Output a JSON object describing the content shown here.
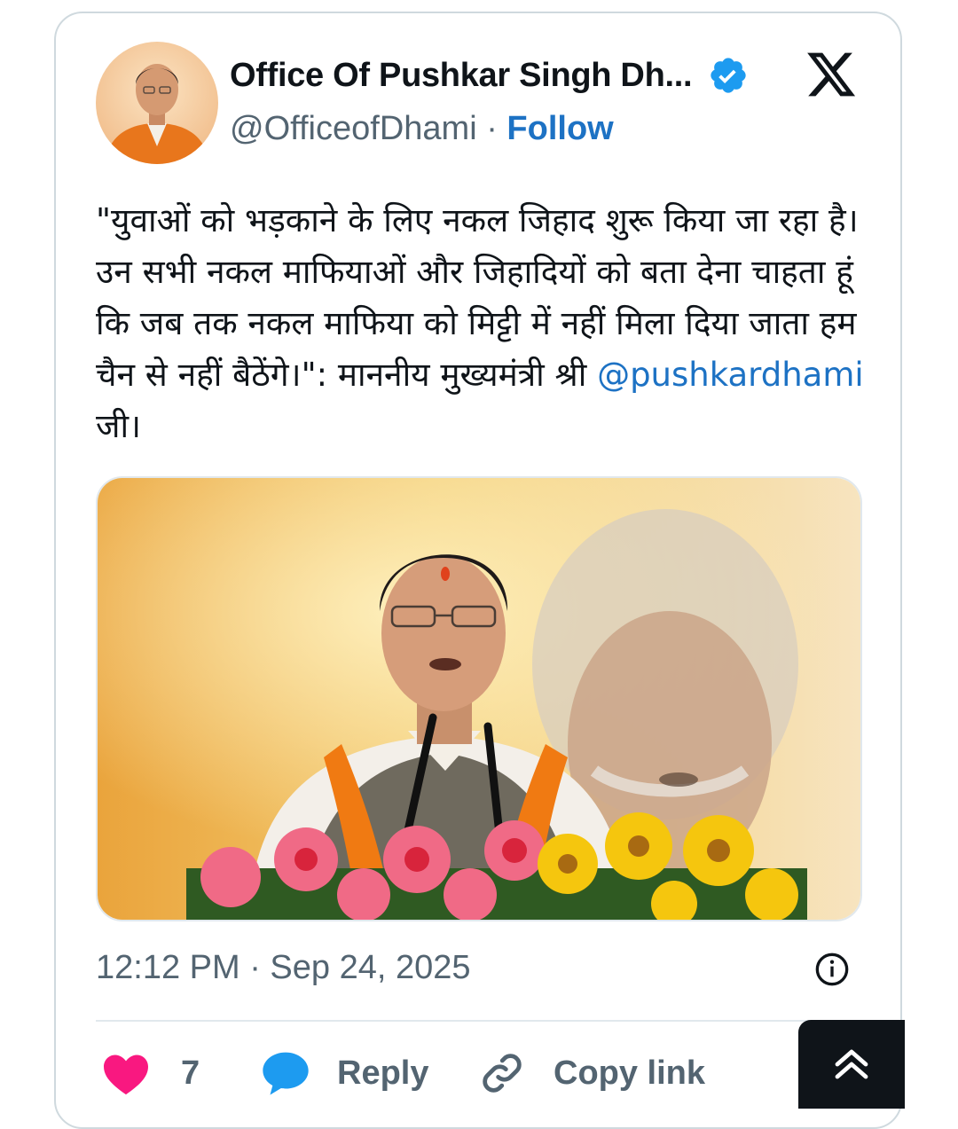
{
  "post": {
    "author_name": "Office Of Pushkar Singh Dh...",
    "handle": "@OfficeofDhami",
    "separator": "·",
    "follow_label": "Follow",
    "text_before": "\"युवाओं को भड़काने के लिए नकल जिहाद शुरू किया जा रहा है। उन सभी नकल माफियाओं और जिहादियों को बता देना चाहता हूं कि जब तक नकल माफिया को मिट्टी में नहीं मिला दिया जाता हम चैन से नहीं बैठेंगे।\": माननीय मुख्यमंत्री श्री ",
    "mention": "@pushkardhami",
    "text_after": " जी।",
    "timestamp": "12:12 PM · Sep 24, 2025"
  },
  "actions": {
    "likes": "7",
    "reply_label": "Reply",
    "copy_link_label": "Copy link"
  },
  "icons": {
    "verified": "verified-badge-icon",
    "logo": "x-logo-icon",
    "info": "info-icon",
    "like": "heart-icon",
    "reply": "speech-bubble-icon",
    "link": "link-icon",
    "scroll": "double-chevron-up-icon"
  },
  "colors": {
    "link_blue": "#1d72c4",
    "verified_blue": "#1d9bf0",
    "heart_pink": "#f91880",
    "muted_text": "#536471",
    "border": "#cfd9de"
  }
}
